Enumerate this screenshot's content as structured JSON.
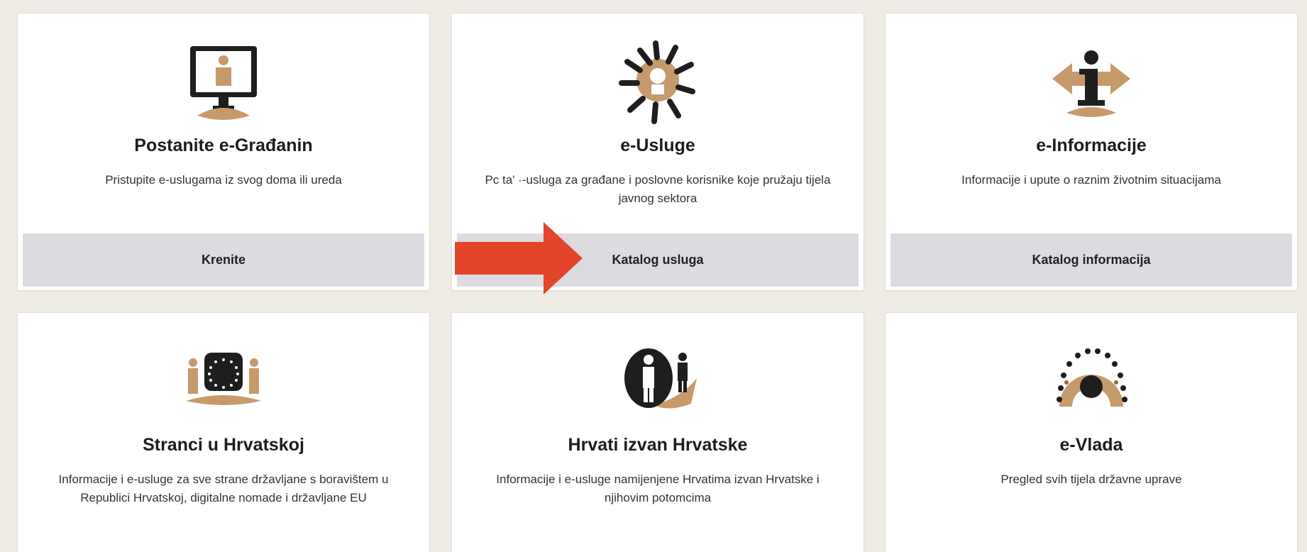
{
  "cards": [
    {
      "title": "Postanite e-Građanin",
      "description": "Pristupite e-uslugama iz svog doma ili ureda",
      "button": "Krenite",
      "icon": "monitor-person-icon"
    },
    {
      "title": "e-Usluge",
      "description": "Pc ta' ·-usluga za građane i poslovne korisnike koje pružaju tijela javnog sektora",
      "button": "Katalog usluga",
      "icon": "people-circle-icon"
    },
    {
      "title": "e-Informacije",
      "description": "Informacije i upute o raznim životnim situacijama",
      "button": "Katalog informacija",
      "icon": "info-person-icon"
    },
    {
      "title": "Stranci u Hrvatskoj",
      "description": "Informacije i e-usluge za sve strane državljane s boravištem u Republici Hrvatskoj, digitalne nomade i državljane EU",
      "icon": "eu-flag-people-icon"
    },
    {
      "title": "Hrvati izvan Hrvatske",
      "description": "Informacije i e-usluge namijenjene Hrvatima izvan Hrvatske i njihovim potomcima",
      "icon": "diaspora-people-icon"
    },
    {
      "title": "e-Vlada",
      "description": "Pregled svih tijela državne uprave",
      "icon": "government-circle-icon"
    }
  ],
  "colors": {
    "accent": "#c79a6b",
    "dark": "#1e1e1e",
    "button_bg": "#dcdbe0",
    "arrow": "#e2452a"
  }
}
